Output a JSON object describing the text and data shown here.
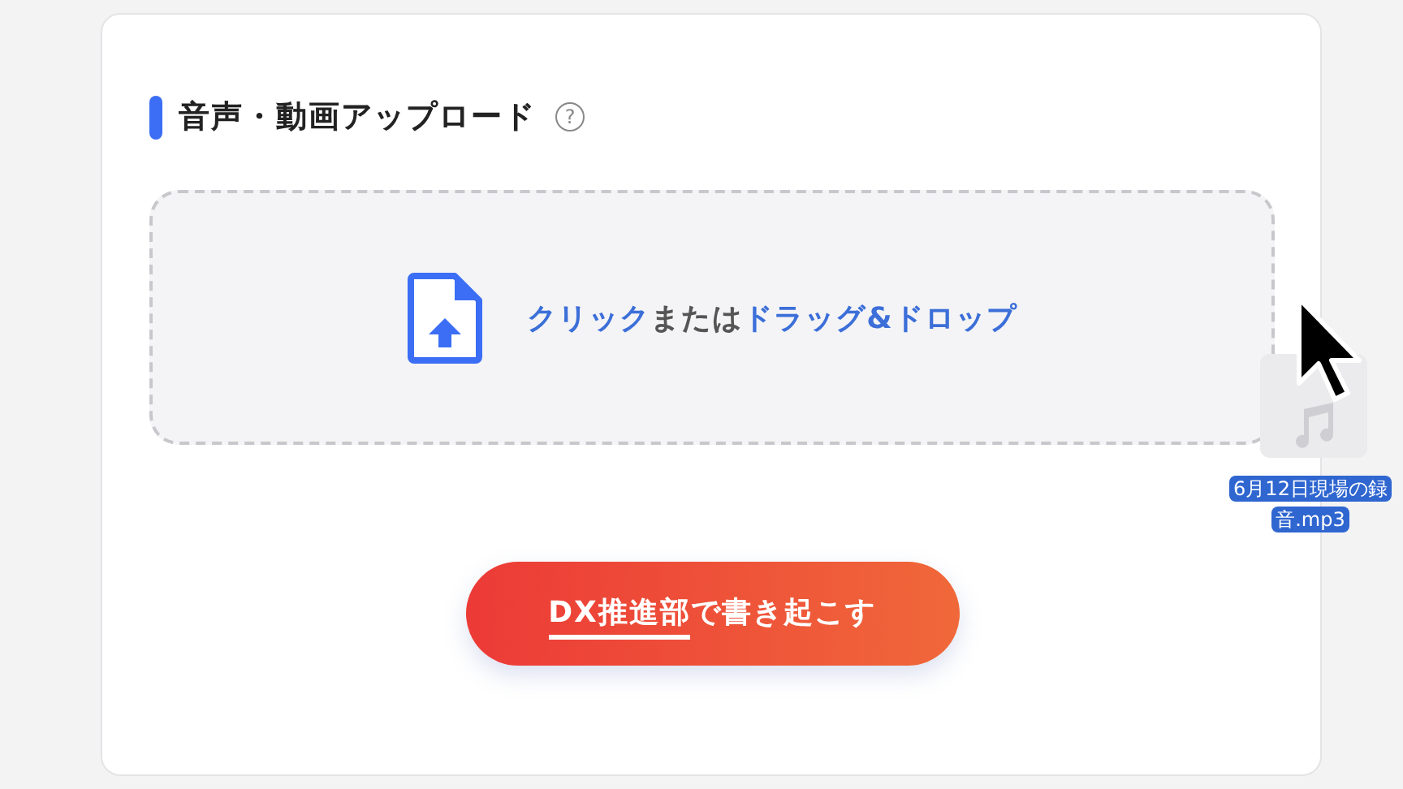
{
  "section": {
    "title": "音声・動画アップロード",
    "help": "?"
  },
  "dropzone": {
    "parts": [
      {
        "text": "クリック",
        "emphasis": true
      },
      {
        "text": "または",
        "emphasis": false
      },
      {
        "text": "ドラッグ&ドロップ",
        "emphasis": true
      }
    ]
  },
  "submit_button": {
    "parts": [
      {
        "text": "DX推進部",
        "underline": true
      },
      {
        "text": "で書き起こす",
        "underline": false
      }
    ]
  },
  "dragged_file": {
    "name": "6月12日現場の録音.mp3"
  }
}
